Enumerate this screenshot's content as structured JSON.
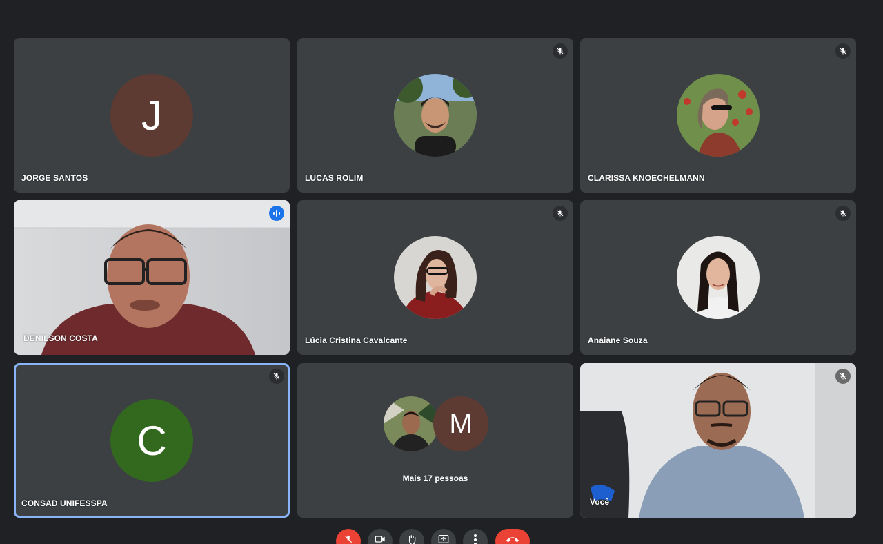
{
  "participants": [
    {
      "name": "JORGE SANTOS",
      "initial": "J",
      "avatar_color": "#5d3b33",
      "muted": false
    },
    {
      "name": "LUCAS ROLIM",
      "muted": true
    },
    {
      "name": "CLARISSA KNOECHELMANN",
      "muted": true
    },
    {
      "name": "DENILSON COSTA",
      "speaking": true
    },
    {
      "name": "Lúcia Cristina Cavalcante",
      "muted": true
    },
    {
      "name": "Anaiane Souza",
      "muted": true
    },
    {
      "name": "CONSAD UNIFESSPA",
      "initial": "C",
      "avatar_color": "#33691e",
      "muted": true
    },
    {
      "more_label": "Mais 17 pessoas",
      "extra_initial": "M",
      "extra_avatar_color": "#5d3b33"
    },
    {
      "name": "Você",
      "muted": true
    }
  ],
  "controls": [
    "mic-off-icon",
    "camera-icon",
    "raise-hand-icon",
    "present-icon",
    "more-options-icon",
    "hang-up-icon"
  ],
  "colors": {
    "background": "#202124",
    "tile": "#3c4043",
    "accent": "#8ab4f8",
    "red": "#ea4335",
    "blue": "#1a73e8"
  }
}
